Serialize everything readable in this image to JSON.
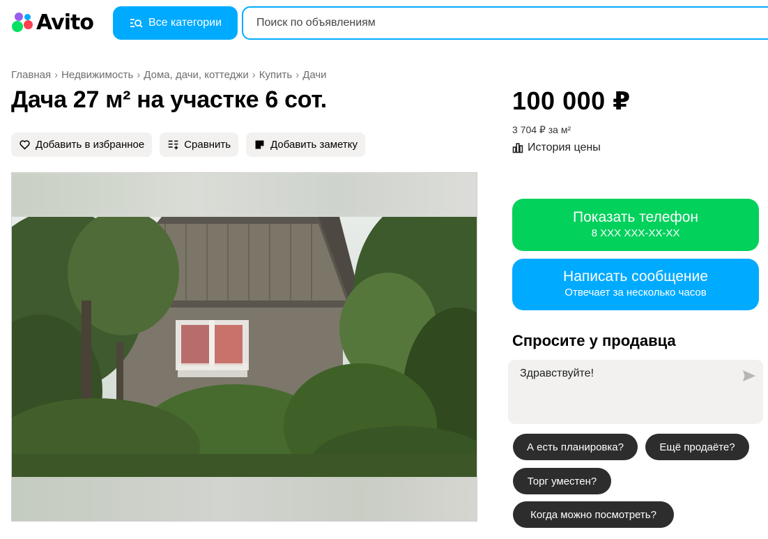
{
  "header": {
    "logo_text": "Avito",
    "categories_button": "Все категории",
    "search_placeholder": "Поиск по объявлениям"
  },
  "breadcrumb": [
    "Главная",
    "Недвижимость",
    "Дома, дачи, коттеджи",
    "Купить",
    "Дачи"
  ],
  "listing": {
    "title": "Дача 27 м² на участке 6 сот.",
    "actions": {
      "favorite": "Добавить в избранное",
      "compare": "Сравнить",
      "note": "Добавить заметку"
    }
  },
  "price": {
    "value": "100 000 ₽",
    "per_m2": "3 704 ₽ за м²",
    "history_label": "История цены"
  },
  "contact": {
    "show_phone": "Показать телефон",
    "phone_masked": "8 XXX XXX-XX-XX",
    "write_message": "Написать сообщение",
    "response_time": "Отвечает за несколько часов"
  },
  "ask_seller": {
    "title": "Спросите у продавца",
    "message_value": "Здравствуйте!",
    "quick_questions": [
      "А есть планировка?",
      "Ещё продаёте?",
      "Торг уместен?",
      "Когда можно посмотреть?"
    ]
  },
  "colors": {
    "accent_blue": "#00aaff",
    "accent_green": "#02d15c",
    "chip_dark": "#2d2d2d"
  }
}
